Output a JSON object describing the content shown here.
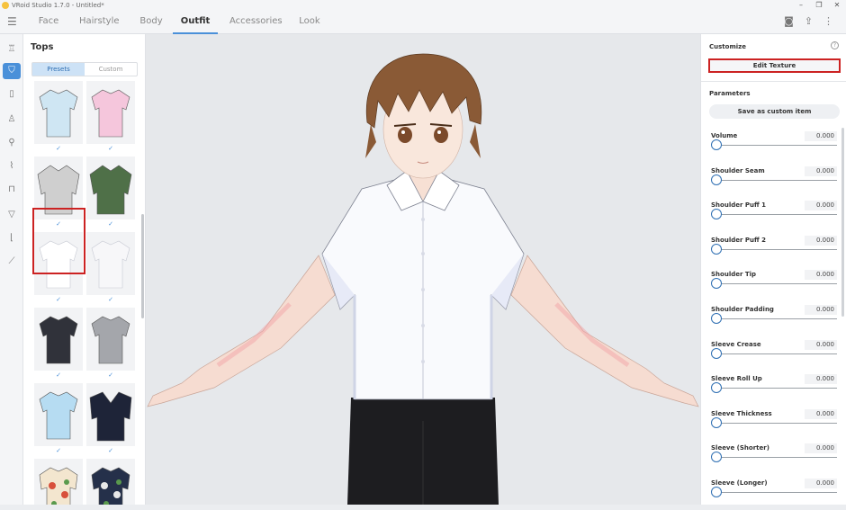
{
  "window": {
    "title": "VRoid Studio 1.7.0 - Untitled*"
  },
  "nav": {
    "tabs": [
      {
        "label": "Face"
      },
      {
        "label": "Hairstyle"
      },
      {
        "label": "Body"
      },
      {
        "label": "Outfit",
        "active": true
      },
      {
        "label": "Accessories"
      },
      {
        "label": "Look"
      }
    ]
  },
  "left_panel": {
    "title": "Tops",
    "segments": [
      {
        "label": "Presets",
        "active": true
      },
      {
        "label": "Custom"
      }
    ],
    "checkmark": "✓",
    "items": [
      {
        "color": "#cfe6f3",
        "kind": "shirt",
        "checked": true
      },
      {
        "color": "#f5c6dc",
        "kind": "shirt",
        "checked": true
      },
      {
        "color": "#cfcfcf",
        "kind": "hoodie",
        "checked": true
      },
      {
        "color": "#4f7048",
        "kind": "hoodie",
        "checked": true
      },
      {
        "color": "#ffffff",
        "kind": "shirt",
        "checked": true,
        "selected": true
      },
      {
        "color": "#f7f7f9",
        "kind": "shirt",
        "checked": true
      },
      {
        "color": "#30323a",
        "kind": "shirt",
        "checked": true
      },
      {
        "color": "#a4a6ab",
        "kind": "shirt",
        "checked": true
      },
      {
        "color": "#b6dcf2",
        "kind": "shirt",
        "checked": true
      },
      {
        "color": "#1e2438",
        "kind": "jacket",
        "checked": true
      },
      {
        "color": "#f3e6cf",
        "kind": "hawaiian",
        "checked": false
      },
      {
        "color": "#25304a",
        "kind": "hawaiian",
        "checked": false
      }
    ]
  },
  "right_panel": {
    "customize_label": "Customize",
    "edit_texture_label": "Edit Texture",
    "parameters_label": "Parameters",
    "save_custom_label": "Save as custom item",
    "params": [
      {
        "label": "Volume",
        "value": "0.000"
      },
      {
        "label": "Shoulder Seam",
        "value": "0.000"
      },
      {
        "label": "Shoulder Puff 1",
        "value": "0.000"
      },
      {
        "label": "Shoulder Puff 2",
        "value": "0.000"
      },
      {
        "label": "Shoulder Tip",
        "value": "0.000"
      },
      {
        "label": "Shoulder Padding",
        "value": "0.000"
      },
      {
        "label": "Sleeve Crease",
        "value": "0.000"
      },
      {
        "label": "Sleeve Roll Up",
        "value": "0.000"
      },
      {
        "label": "Sleeve Thickness",
        "value": "0.000"
      },
      {
        "label": "Sleeve (Shorter)",
        "value": "0.000"
      },
      {
        "label": "Sleeve (Longer)",
        "value": "0.000"
      }
    ]
  },
  "colors": {
    "accent": "#4a90d9",
    "highlight": "#cc2222"
  }
}
